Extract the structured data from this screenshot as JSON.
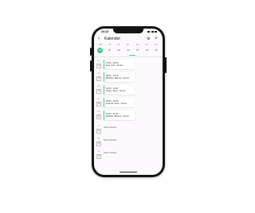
{
  "status": {
    "time": "20:10"
  },
  "appbar": {
    "back_glyph": "‹",
    "title": "Kalender",
    "settings_glyph": "⚙",
    "add_glyph": "+"
  },
  "accent": "#43c78d",
  "week": {
    "day_names": [
      "MO",
      "DI",
      "MI",
      "DO",
      "FR",
      "SA",
      "SO"
    ],
    "dates": [
      "20",
      "21",
      "22",
      "23",
      "24",
      "25",
      "26"
    ],
    "selected_index": 0
  },
  "agenda": [
    {
      "weekday": "MO",
      "day": "20",
      "time": "07:00 - 08:00",
      "name": "Eins, Karl - Termin"
    },
    {
      "weekday": "MO",
      "day": "20",
      "time": "08:00 - 10:00",
      "name": "Böttcher, Bianca - Termin"
    },
    {
      "weekday": "MO",
      "day": "20",
      "time": "12:00 - 14:00",
      "name": "Reger, Janis - Termin"
    },
    {
      "weekday": "MO",
      "day": "20",
      "time": "08:00 - 09:00",
      "name": "Schmidt, Nina - Termin"
    },
    {
      "weekday": "MO",
      "day": "20",
      "time": "10:00 - 11:00",
      "name": "Böttcher, Bianca - Termin"
    }
  ],
  "empty_days": [
    {
      "weekday": "DI",
      "day": "21",
      "label": "Keine Termine"
    },
    {
      "weekday": "MI",
      "day": "22",
      "label": "Keine Termine"
    },
    {
      "weekday": "DO",
      "day": "23",
      "label": "Keine Termine"
    }
  ]
}
